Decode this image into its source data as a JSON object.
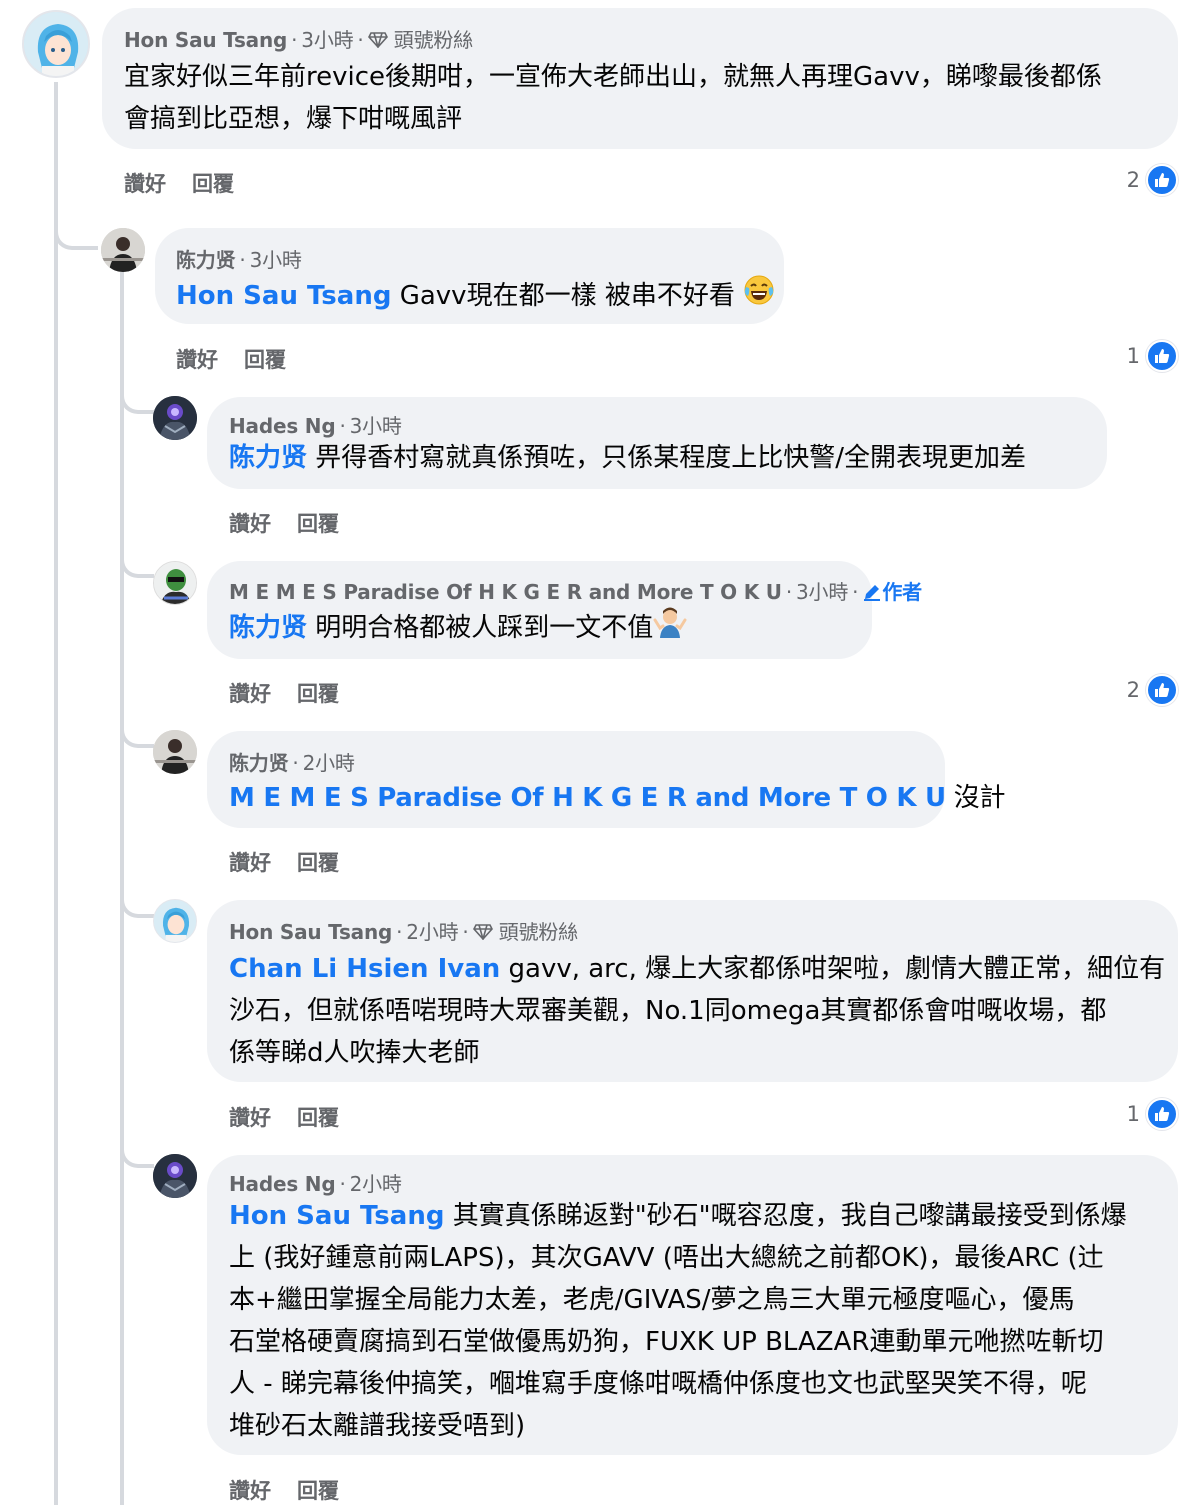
{
  "comments": [
    {
      "author": "Hon Sau Tsang",
      "time": "3小時",
      "badge": "頭號粉絲",
      "text_line1": "宜家好似三年前revice後期咁，一宣佈大老師出山，就無人再理Gavv，睇嚟最後都係",
      "text_line2": "會搞到比亞想，爆下咁嘅風評",
      "like_label": "讚好",
      "reply_label": "回覆",
      "reactions": "2"
    },
    {
      "author": "陈力贤",
      "time": "3小時",
      "mention": "Hon Sau Tsang",
      "text": " Gavv現在都一樣 被串不好看 ",
      "emoji": "laughing-crying-emoji",
      "like_label": "讚好",
      "reply_label": "回覆",
      "reactions": "1"
    },
    {
      "author": "Hades Ng",
      "time": "3小時",
      "mention": "陈力贤",
      "text": " 畀得香村寫就真係預咗，只係某程度上比快警/全開表現更加差",
      "like_label": "讚好",
      "reply_label": "回覆"
    },
    {
      "author": "M E M E S Paradise Of H K G E R and More T O K U",
      "time": "3小時",
      "author_badge": "作者",
      "mention": "陈力贤",
      "text": " 明明合格都被人踩到一文不值",
      "emoji": "shrugging-person-emoji",
      "like_label": "讚好",
      "reply_label": "回覆",
      "reactions": "2"
    },
    {
      "author": "陈力贤",
      "time": "2小時",
      "mention": "M E M E S Paradise Of H K G E R and More T O K U",
      "text": " 沒計",
      "like_label": "讚好",
      "reply_label": "回覆"
    },
    {
      "author": "Hon Sau Tsang",
      "time": "2小時",
      "badge": "頭號粉絲",
      "mention": "Chan Li Hsien Ivan",
      "text_line1": " gavv, arc, 爆上大家都係咁架啦，劇情大體正常，細位有",
      "text_line2": "沙石，但就係唔啱現時大眾審美觀，No.1同omega其實都係會咁嘅收場，都",
      "text_line3": "係等睇d人吹捧大老師",
      "like_label": "讚好",
      "reply_label": "回覆",
      "reactions": "1"
    },
    {
      "author": "Hades Ng",
      "time": "2小時",
      "mention": "Hon Sau Tsang",
      "text_line1": " 其實真係睇返對\"砂石\"嘅容忍度，我自己嚟講最接受到係爆",
      "text_line2": "上 (我好鍾意前兩LAPS)，其次GAVV (唔出大總統之前都OK)，最後ARC (辻",
      "text_line3": "本+繼田掌握全局能力太差，老虎/GIVAS/夢之鳥三大單元極度嘔心，優馬",
      "text_line4": "石堂格硬賣腐搞到石堂做優馬奶狗，FUXK UP BLAZAR連動單元咃撚咗斬切",
      "text_line5": "人 - 睇完幕後仲搞笑，嗰堆寫手度條咁嘅橋仲係度也文也武堅哭笑不得，呢",
      "text_line6": "堆砂石太離譜我接受唔到)",
      "like_label": "讚好",
      "reply_label": "回覆"
    }
  ],
  "colors": {
    "mention": "#1877f2",
    "bubble": "#f0f2f5",
    "meta": "#65676b",
    "like": "#1877f2"
  }
}
